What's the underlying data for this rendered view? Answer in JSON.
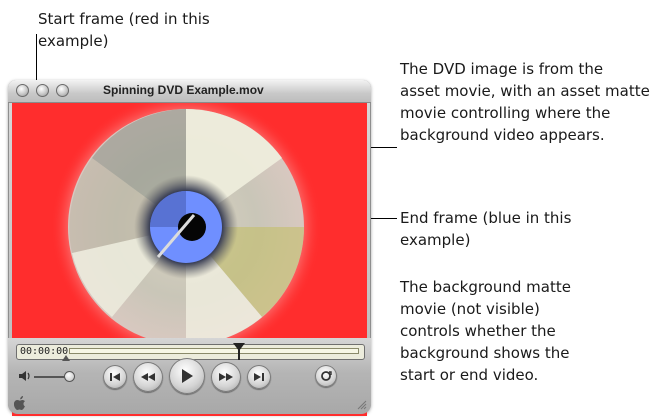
{
  "window": {
    "title": "Spinning DVD Example.mov"
  },
  "controller": {
    "timecode": "00:00:00"
  },
  "callouts": {
    "start_frame": [
      "Start frame (red in this",
      "example)"
    ],
    "dvd_image": [
      "The DVD image is from the",
      "asset movie, with an asset matte",
      "movie controlling where the",
      "background video appears."
    ],
    "end_frame": [
      "End frame (blue in this",
      "example)"
    ],
    "background_matte": [
      "The background matte",
      "movie (not visible)",
      "controls whether the",
      "background shows the",
      "start or end video."
    ]
  },
  "colors": {
    "start_frame_red": "#ff2d2d",
    "end_frame_blue": "#6f8fff",
    "window_chrome": "#bdbdbd"
  },
  "icons": [
    "close-button-icon",
    "minimize-button-icon",
    "zoom-button-icon",
    "volume-icon",
    "skip-to-start-icon",
    "rewind-icon",
    "play-icon",
    "fast-forward-icon",
    "skip-to-end-icon",
    "loop-icon",
    "apple-icon",
    "resize-grip-icon"
  ]
}
